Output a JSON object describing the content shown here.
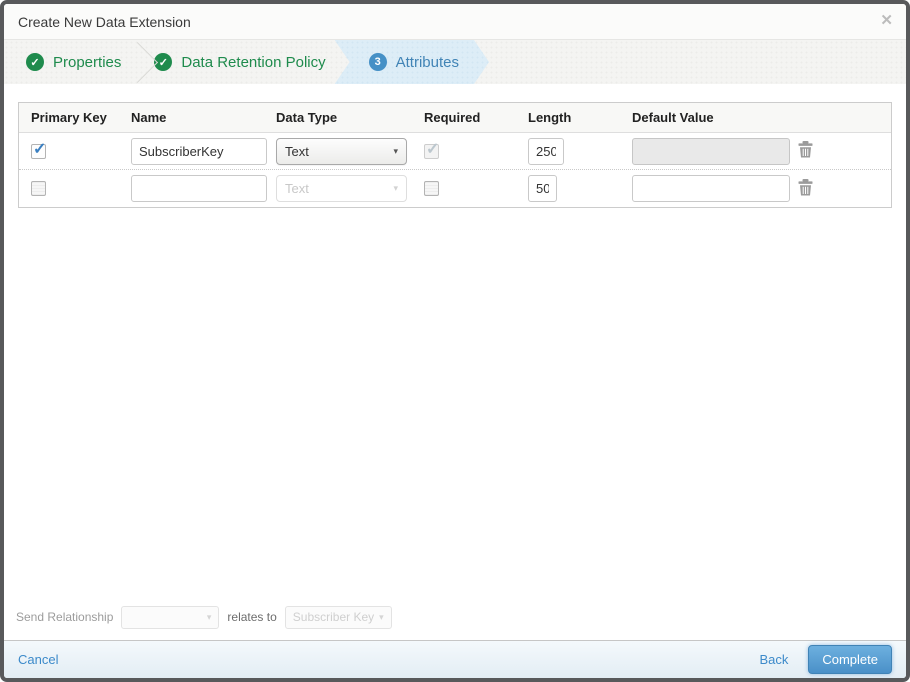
{
  "dialog": {
    "title": "Create New Data Extension"
  },
  "icons": {
    "close": "✕",
    "dropdown_arrow": "▾",
    "check": "✓"
  },
  "wizard": {
    "steps": [
      {
        "label": "Properties",
        "status": "complete"
      },
      {
        "label": "Data Retention Policy",
        "status": "complete"
      },
      {
        "label": "Attributes",
        "status": "current",
        "number": "3"
      }
    ]
  },
  "attributes_table": {
    "headers": [
      "Primary Key",
      "Name",
      "Data Type",
      "Required",
      "Length",
      "Default Value"
    ],
    "rows": [
      {
        "primary_key": true,
        "name": "SubscriberKey",
        "data_type": "Text",
        "data_type_disabled": false,
        "required": true,
        "required_disabled": true,
        "length": "250",
        "default_value": "",
        "default_value_disabled": true
      },
      {
        "primary_key": false,
        "name": "",
        "data_type": "Text",
        "data_type_disabled": true,
        "required": false,
        "required_disabled": false,
        "length": "50",
        "default_value": "",
        "default_value_disabled": false
      }
    ]
  },
  "send_relationship": {
    "label": "Send Relationship",
    "selected_field": "",
    "relates_to": "relates to",
    "target_field": "Subscriber Key"
  },
  "footer": {
    "cancel": "Cancel",
    "back": "Back",
    "complete": "Complete"
  },
  "colors": {
    "step_complete_green": "#1f8b4d",
    "step_current_blue": "#4184b6",
    "step_current_bg": "#ddedf7",
    "link_blue": "#3c8aca",
    "button_blue_top": "#6db0df",
    "button_blue_bottom": "#4a90c8",
    "dialog_border": "#58595b",
    "checkbox_check_blue": "#3a7fc1"
  }
}
